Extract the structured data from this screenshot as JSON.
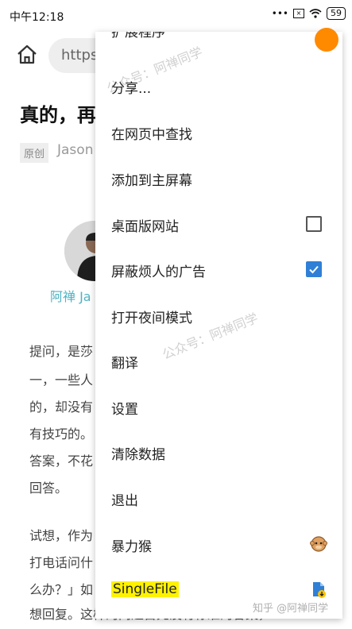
{
  "status_bar": {
    "time": "中午12:18",
    "dots": "•••",
    "signal_box": "×",
    "battery": "59"
  },
  "toolbar": {
    "url_partial": "https"
  },
  "article": {
    "title_partial": "真的，再",
    "badge": "原创",
    "author_partial": "Jason",
    "author_name_partial": "阿禅 Ja",
    "para1": [
      "提问，是莎",
      "一，一些人",
      "的，却没有",
      "有技巧的。",
      "答案，不花",
      "回答。"
    ],
    "para2": [
      "试想，作为",
      "打电话问什",
      "么办？」如",
      "想回复。这样的问题首先没有标准的答案，"
    ]
  },
  "menu": {
    "items": [
      {
        "label": "扩展程序"
      },
      {
        "label": "分享..."
      },
      {
        "label": "在网页中查找"
      },
      {
        "label": "添加到主屏幕"
      },
      {
        "label": "桌面版网站",
        "checked": false
      },
      {
        "label": "屏蔽烦人的广告",
        "checked": true
      },
      {
        "label": "打开夜间模式"
      },
      {
        "label": "翻译"
      },
      {
        "label": "设置"
      },
      {
        "label": "清除数据"
      },
      {
        "label": "退出"
      },
      {
        "label": "暴力猴"
      },
      {
        "label": "SingleFile"
      }
    ]
  },
  "watermarks": {
    "w1": "公众号：阿禅同学",
    "w2": "公众号：阿禅同学",
    "footer": "知乎 @阿禅同学"
  },
  "colors": {
    "accent_blue": "#2f7fd6",
    "author_cyan": "#4fb3c2",
    "orange_dot": "#ff8a00",
    "highlight": "#fff200"
  }
}
